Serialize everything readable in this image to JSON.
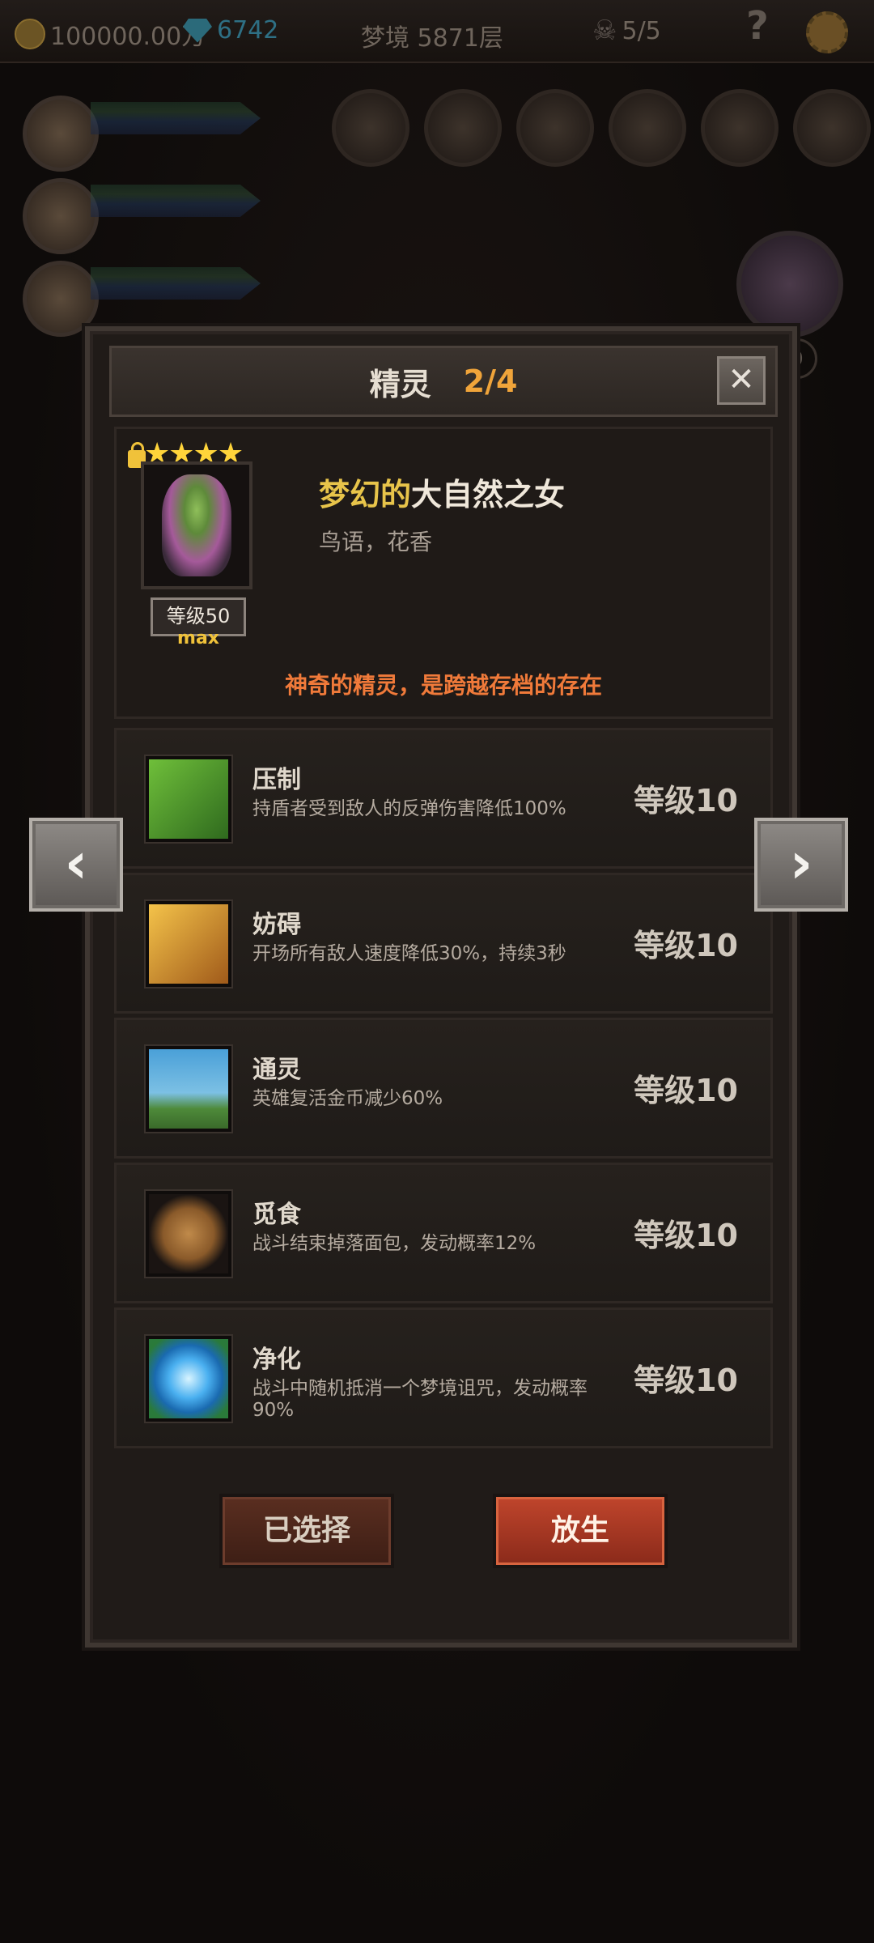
{
  "topbar": {
    "gold": "100000.00万",
    "gems": "6742",
    "stage": "梦境 5871层",
    "skulls": "5/5",
    "help": "?"
  },
  "side": {
    "big_slot_count": "0"
  },
  "dialog": {
    "title": "精灵",
    "page": "2/4",
    "close": "✕",
    "spirit": {
      "stars": "★★★★",
      "level_label": "等级50",
      "max_label": "max",
      "name_prefix": "梦幻的",
      "name_suffix": "大自然之女",
      "tags": "鸟语，花香",
      "description": "神奇的精灵，是跨越存档的存在"
    },
    "skills": [
      {
        "name": "压制",
        "desc": "持盾者受到敌人的反弹伤害降低100%",
        "level": "等级10",
        "icon": "claw-grass-icon",
        "color": "#4f8a2e"
      },
      {
        "name": "妨碍",
        "desc": "开场所有敌人速度降低30%，持续3秒",
        "level": "等级10",
        "icon": "chained-boot-icon",
        "color": "#c07a1e"
      },
      {
        "name": "通灵",
        "desc": "英雄复活金币减少60%",
        "level": "等级10",
        "icon": "tombstone-icon",
        "color": "#3f8ab0"
      },
      {
        "name": "觅食",
        "desc": "战斗结束掉落面包，发动概率12%",
        "level": "等级10",
        "icon": "gingerbread-icon",
        "color": "#6a4a2a"
      },
      {
        "name": "净化",
        "desc": "战斗中随机抵消一个梦境诅咒，发动概率90%",
        "level": "等级10",
        "icon": "blue-flower-icon",
        "color": "#2a8ad0"
      }
    ],
    "buttons": {
      "selected": "已选择",
      "release": "放生"
    }
  },
  "nav": {
    "prev": "‹",
    "next": "›"
  }
}
